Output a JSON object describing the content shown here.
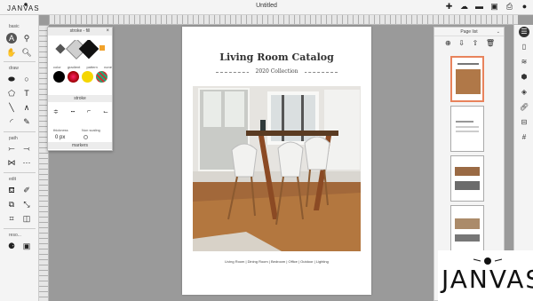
{
  "app": {
    "logo_text": "JANVAS",
    "doc_title": "Untitled"
  },
  "topbar": {
    "icons": [
      "add-icon",
      "share-icon",
      "device-icon",
      "save-icon",
      "print-icon",
      "user-icon"
    ]
  },
  "left_toolbar": {
    "sections": [
      "basic",
      "draw",
      "path",
      "edit",
      "reso..."
    ]
  },
  "stroke_panel": {
    "title": "stroke - fill",
    "color_labels": [
      "color",
      "gradient",
      "pattern",
      "none"
    ],
    "stroke_label": "stroke",
    "thickness_label": "thickness",
    "thickness_value": "0 px",
    "non_scaling_label": "Non scaling",
    "markers_label": "markers",
    "colors": {
      "black": "#000000",
      "yellow": "#f5d600",
      "red": "#d02424"
    }
  },
  "page": {
    "title": "Living Room Catalog",
    "subtitle": "2020 Collection",
    "nav": "Living Room  |  Dining Room  |  Bedroom  |  Office  |  Outdoor  |  Lighting"
  },
  "pages_panel": {
    "title": "Page list"
  },
  "watermark": {
    "text": "JANVAS"
  },
  "colors": {
    "accent": "#e8835c",
    "toolbar_bg": "#f4f4f4",
    "canvas_bg": "#9a9a9a"
  }
}
